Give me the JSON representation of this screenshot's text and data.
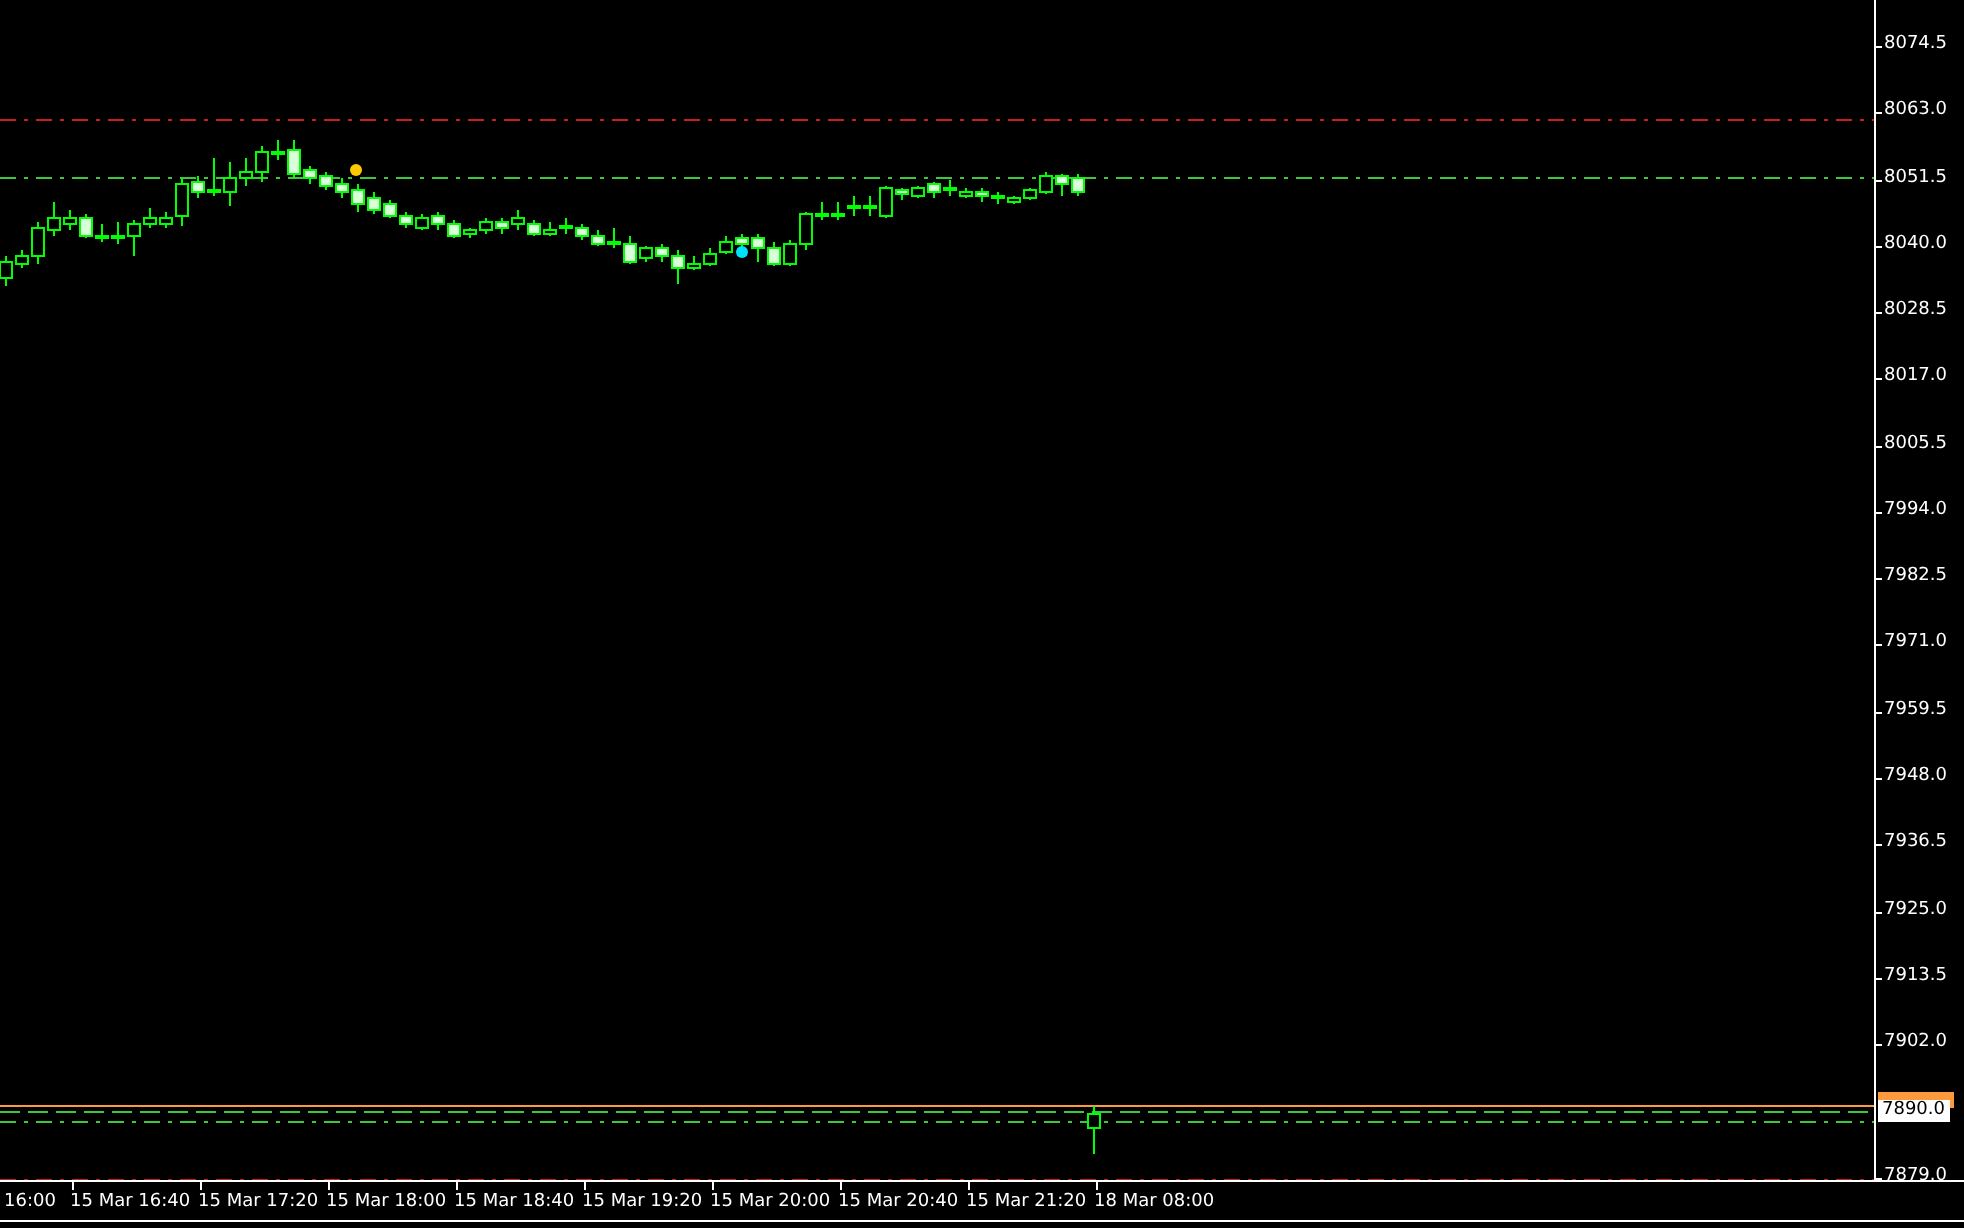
{
  "price_axis": {
    "labels": [
      "8074.5",
      "8063.0",
      "8051.5",
      "8040.0",
      "8028.5",
      "8017.0",
      "8005.5",
      "7994.0",
      "7982.5",
      "7971.0",
      "7959.5",
      "7948.0",
      "7936.5",
      "7925.0",
      "7913.5",
      "7902.0",
      "7879.0"
    ],
    "current_price": "7890.0"
  },
  "time_axis": {
    "labels": [
      "16:00",
      "15 Mar 16:40",
      "15 Mar 17:20",
      "15 Mar 18:00",
      "15 Mar 18:40",
      "15 Mar 19:20",
      "15 Mar 20:00",
      "15 Mar 20:40",
      "15 Mar 21:20",
      "18 Mar 08:00"
    ]
  },
  "levels": [
    {
      "kind": "dashdot",
      "color": "#c81e1e"
    },
    {
      "kind": "dashdot",
      "color": "#3cc83c"
    },
    {
      "kind": "solid",
      "color": "#ff9a3c"
    },
    {
      "kind": "dashed",
      "color": "#3cc83c"
    },
    {
      "kind": "dashdot",
      "color": "#3cc83c"
    },
    {
      "kind": "dashdot",
      "color": "#c81e1e"
    }
  ],
  "markers": [
    {
      "color": "#ffc800"
    },
    {
      "color": "#00e0ff"
    }
  ]
}
